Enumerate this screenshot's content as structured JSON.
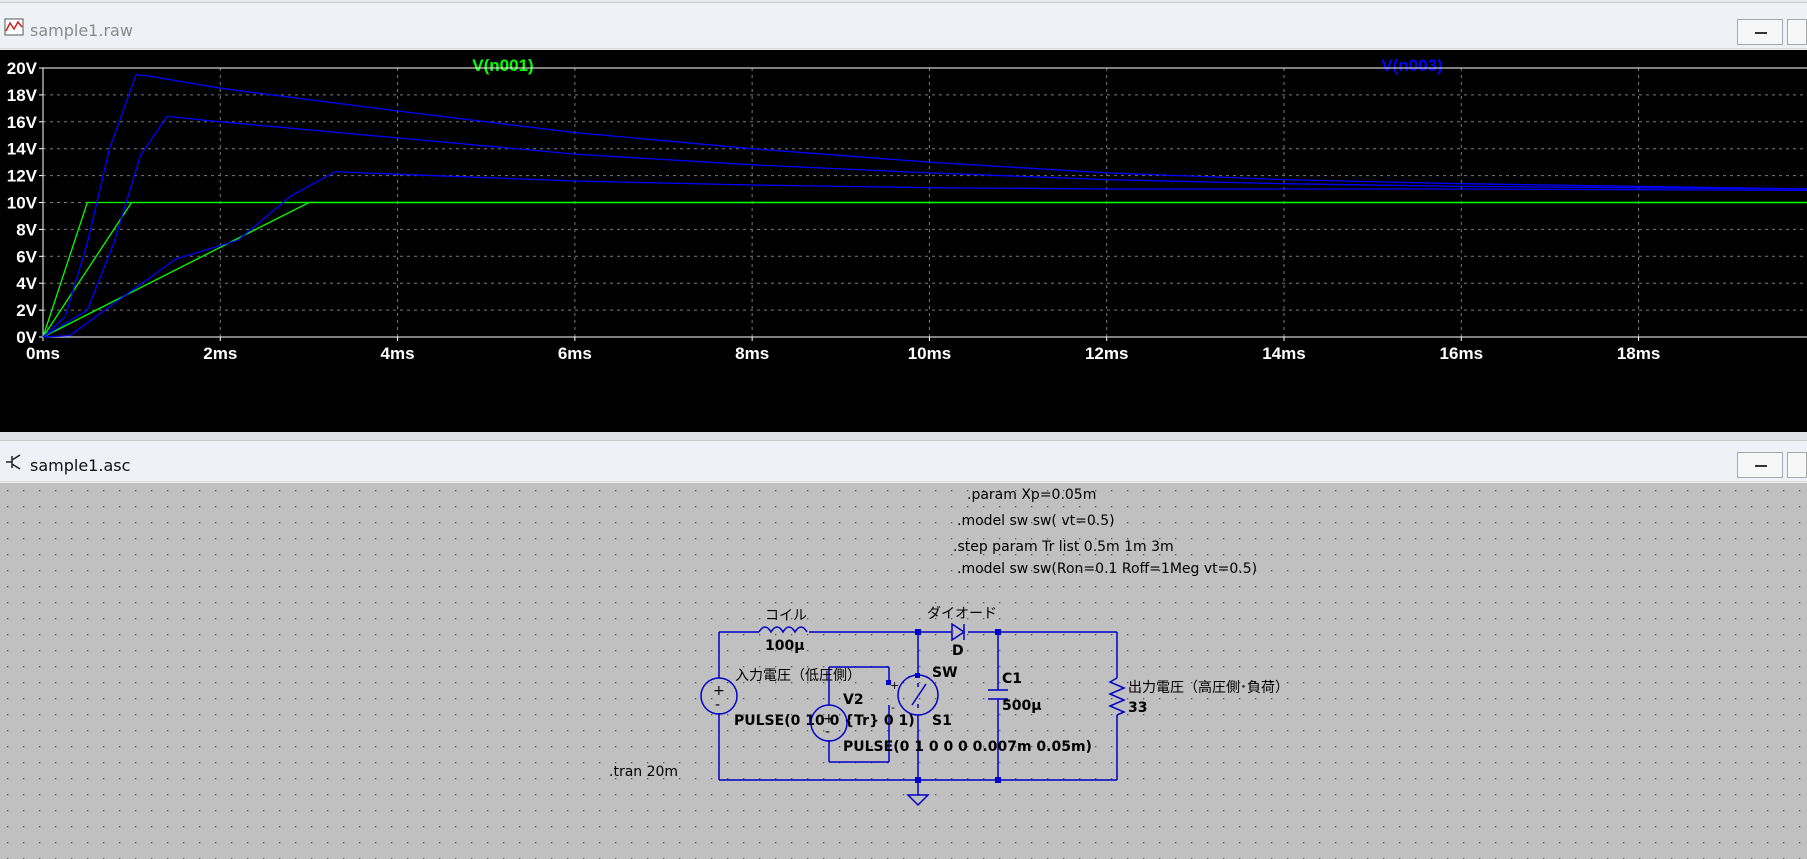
{
  "plot_window": {
    "title": "sample1.raw",
    "trace_labels": [
      "V(n001)",
      "V(n003)"
    ],
    "colors": {
      "background": "#000000",
      "trace1": "#00ff00",
      "trace2": "#0000ff",
      "grid": "#808080",
      "axis_text": "#ffffff"
    }
  },
  "chart_data": {
    "type": "line",
    "xlabel": "",
    "ylabel": "",
    "x_ticks": [
      "0ms",
      "2ms",
      "4ms",
      "6ms",
      "8ms",
      "10ms",
      "12ms",
      "14ms",
      "16ms",
      "18ms"
    ],
    "y_ticks": [
      "0V",
      "2V",
      "4V",
      "6V",
      "8V",
      "10V",
      "12V",
      "14V",
      "16V",
      "18V",
      "20V"
    ],
    "xlim": [
      0,
      19.9
    ],
    "ylim": [
      0,
      20
    ],
    "grid": true,
    "series": [
      {
        "name": "V(n001)",
        "color": "#00ff00",
        "x": [
          0,
          0.5,
          19.9
        ],
        "y": [
          0,
          10,
          10
        ]
      },
      {
        "name": "V(n001)",
        "color": "#00ff00",
        "x": [
          0,
          1,
          19.9
        ],
        "y": [
          0,
          10,
          10
        ]
      },
      {
        "name": "V(n001)",
        "color": "#00ff00",
        "x": [
          0,
          3,
          19.9
        ],
        "y": [
          0,
          10,
          10
        ]
      },
      {
        "name": "V(n003)",
        "color": "#0000ff",
        "x": [
          0,
          0.25,
          0.5,
          0.75,
          1.05,
          1.2,
          2,
          4,
          6,
          8,
          10,
          12,
          14,
          16,
          18,
          19.9
        ],
        "y": [
          0,
          1.5,
          7,
          14,
          19.5,
          19.4,
          18.5,
          16.8,
          15.2,
          14.0,
          13.0,
          12.2,
          11.7,
          11.4,
          11.2,
          11.0
        ]
      },
      {
        "name": "V(n003)",
        "color": "#0000ff",
        "x": [
          0,
          0.5,
          0.8,
          1.1,
          1.4,
          2,
          4,
          6,
          8,
          10,
          12,
          14,
          16,
          18,
          19.9
        ],
        "y": [
          0,
          2,
          7,
          13.5,
          16.4,
          16.0,
          14.8,
          13.6,
          12.8,
          12.2,
          11.7,
          11.4,
          11.2,
          11.1,
          11.0
        ]
      },
      {
        "name": "V(n003)",
        "color": "#0000ff",
        "x": [
          0,
          0.3,
          0.8,
          1.5,
          2.2,
          2.8,
          3.3,
          4,
          6,
          8,
          10,
          12,
          14,
          16,
          18,
          19.9
        ],
        "y": [
          0,
          0.1,
          2.5,
          5.8,
          7.2,
          10.5,
          12.3,
          12.1,
          11.6,
          11.3,
          11.1,
          11.0,
          11.0,
          11.0,
          10.95,
          10.9
        ]
      }
    ]
  },
  "schematic_window": {
    "title": "sample1.asc",
    "directives": [
      ".param Xp=0.05m",
      ".model sw sw( vt=0.5)",
      ".step param Tr list 0.5m 1m 3m",
      ".model sw sw(Ron=0.1 Roff=1Meg vt=0.5)"
    ],
    "tran": ".tran 20m",
    "inductor": {
      "name": "コイル",
      "value": "100μ"
    },
    "diode": {
      "name": "ダイオード",
      "model": "D"
    },
    "capacitor": {
      "name": "C1",
      "value": "500μ"
    },
    "resistor": {
      "name": "出力電圧（高圧側･負荷）",
      "value": "33"
    },
    "v1": {
      "name": "入力電圧（低圧側）",
      "value": "PULSE(0 10 0 {Tr} 0 1)"
    },
    "v2": {
      "name": "V2",
      "value": "PULSE(0 1 0 0 0 0.007m 0.05m)"
    },
    "switch": {
      "name": "S1",
      "model": "SW"
    },
    "colors": {
      "background": "#c0c0c0",
      "wire": "#0000c8",
      "text": "#000000"
    }
  }
}
